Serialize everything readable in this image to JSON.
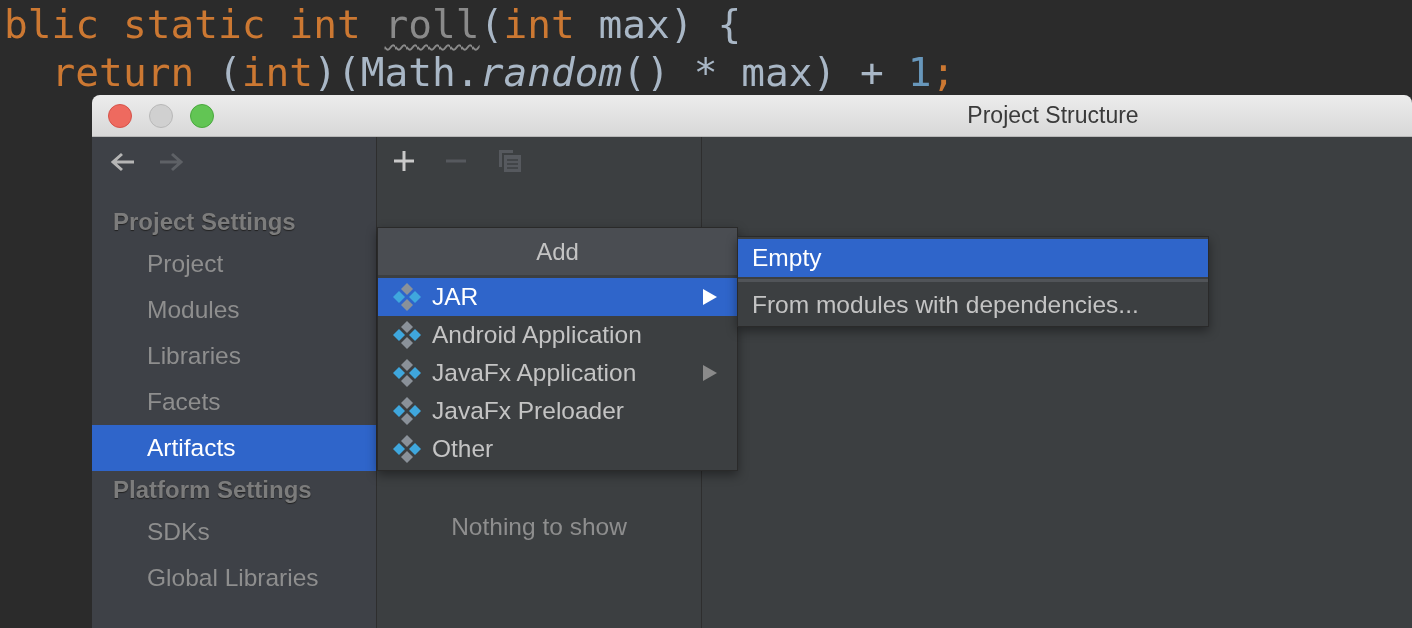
{
  "editor": {
    "lines": [
      {
        "tokens": [
          {
            "kind": "keyword",
            "text": "blic static int "
          },
          {
            "kind": "unused",
            "text": "roll"
          },
          {
            "kind": "plain",
            "text": "("
          },
          {
            "kind": "keyword",
            "text": "int"
          },
          {
            "kind": "plain",
            "text": " max) {"
          }
        ]
      },
      {
        "tokens": [
          {
            "kind": "keyword",
            "text": "  return "
          },
          {
            "kind": "plain",
            "text": "("
          },
          {
            "kind": "keyword",
            "text": "int"
          },
          {
            "kind": "plain",
            "text": ")(Math."
          },
          {
            "kind": "italic",
            "text": "random"
          },
          {
            "kind": "plain",
            "text": "() * max) + "
          },
          {
            "kind": "number",
            "text": "1"
          },
          {
            "kind": "keyword",
            "text": ";"
          }
        ]
      }
    ]
  },
  "window": {
    "title": "Project Structure",
    "navigation": [
      {
        "kind": "back",
        "disabled": false
      },
      {
        "kind": "forward",
        "disabled": true
      }
    ],
    "sidebar": {
      "sections": [
        {
          "title": "Project Settings",
          "items": [
            {
              "label": "Project",
              "selected": false
            },
            {
              "label": "Modules",
              "selected": false
            },
            {
              "label": "Libraries",
              "selected": false
            },
            {
              "label": "Facets",
              "selected": false
            },
            {
              "label": "Artifacts",
              "selected": true
            }
          ]
        },
        {
          "title": "Platform Settings",
          "items": [
            {
              "label": "SDKs",
              "selected": false
            },
            {
              "label": "Global Libraries",
              "selected": false
            }
          ]
        }
      ]
    },
    "toolbar": [
      {
        "kind": "add",
        "disabled": false
      },
      {
        "kind": "remove",
        "disabled": true
      },
      {
        "kind": "copy",
        "disabled": true
      }
    ],
    "empty_text": "Nothing to show",
    "popup": {
      "title": "Add",
      "items": [
        {
          "label": "JAR",
          "selected": true,
          "submenu": true
        },
        {
          "label": "Android Application",
          "selected": false,
          "submenu": false
        },
        {
          "label": "JavaFx Application",
          "selected": false,
          "submenu": true
        },
        {
          "label": "JavaFx Preloader",
          "selected": false,
          "submenu": false
        },
        {
          "label": "Other",
          "selected": false,
          "submenu": false
        }
      ]
    },
    "submenu": {
      "items": [
        {
          "label": "Empty",
          "selected": true
        },
        {
          "label": "From modules with dependencies...",
          "selected": false
        }
      ]
    }
  }
}
